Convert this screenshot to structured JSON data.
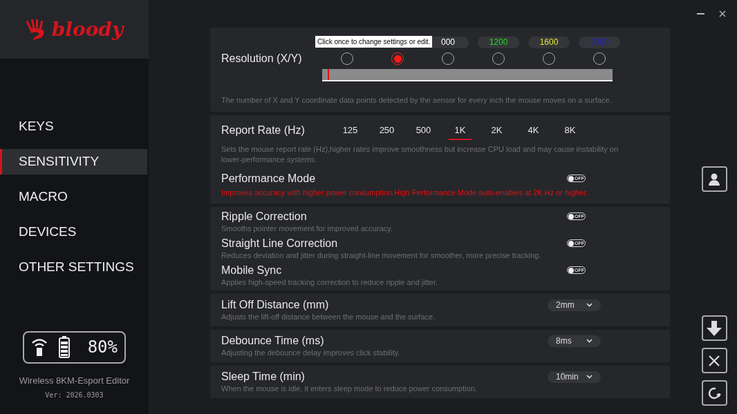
{
  "logo": {
    "text": "bloody"
  },
  "nav": [
    {
      "label": "KEYS",
      "selected": false
    },
    {
      "label": "SENSITIVITY",
      "selected": true
    },
    {
      "label": "MACRO",
      "selected": false
    },
    {
      "label": "DEVICES",
      "selected": false
    },
    {
      "label": "OTHER SETTINGS",
      "selected": false
    }
  ],
  "status": {
    "battery": "80%",
    "product": "Wireless 8KM-Esport Editor",
    "version": "Ver: 2026.0303"
  },
  "resolution": {
    "title": "Resolution (X/Y)",
    "tooltip": "Click once to change settings or edit.",
    "levels": [
      {
        "selected": false
      },
      {
        "selected": true
      },
      {
        "label": "000",
        "color": "#ffffff",
        "selected": false
      },
      {
        "label": "1200",
        "color": "#22dd22",
        "selected": false
      },
      {
        "label": "1600",
        "color": "#e6e62e",
        "selected": false
      },
      {
        "label": "2000",
        "color": "#2222cc",
        "selected": false
      }
    ],
    "level": 0.02,
    "description": "The number of X and Y coordinate data points detected by the sensor for every inch the mouse moves on a surface."
  },
  "report_rate": {
    "title": "Report Rate (Hz)",
    "options": [
      {
        "label": "125",
        "selected": false
      },
      {
        "label": "250",
        "selected": false
      },
      {
        "label": "500",
        "selected": false
      },
      {
        "label": "1K",
        "selected": true
      },
      {
        "label": "2K",
        "selected": false
      },
      {
        "label": "4K",
        "selected": false
      },
      {
        "label": "8K",
        "selected": false
      }
    ],
    "description": "Sets the mouse report rate (Hz),higher rates improve smoothness but increase CPU load and may cause instability on lower-performance systems.",
    "performance": {
      "title": "Performance Mode",
      "on": false,
      "switch_label": "OFF",
      "description": "Improves accuracy with higher power consumption.High Performance Mode auto-enables at 2K Hz or higher."
    }
  },
  "toggles": [
    {
      "title": "Ripple Correction",
      "description": "Smooths pointer movement for improved accuracy.",
      "on": false,
      "switch_label": "OFF"
    },
    {
      "title": "Straight Line Correction",
      "description": "Reduces deviation and jitter during straight-line movement for smoother, more precise tracking.",
      "on": false,
      "switch_label": "OFF"
    },
    {
      "title": "Mobile Sync",
      "description": "Applies high-speed tracking correction to reduce ripple and jitter.",
      "on": false,
      "switch_label": "OFF"
    }
  ],
  "selects": [
    {
      "title": "Lift Off Distance (mm)",
      "description": "Adjusts the lift-off distance between the mouse and the surface.",
      "value": "2mm"
    },
    {
      "title": "Debounce Time (ms)",
      "description": "Adjusting the debounce delay improves click stability.",
      "value": "8ms"
    },
    {
      "title": "Sleep Time (min)",
      "description": "When the mouse is idle, it enters sleep mode to reduce power consumption.",
      "value": "10min"
    }
  ]
}
